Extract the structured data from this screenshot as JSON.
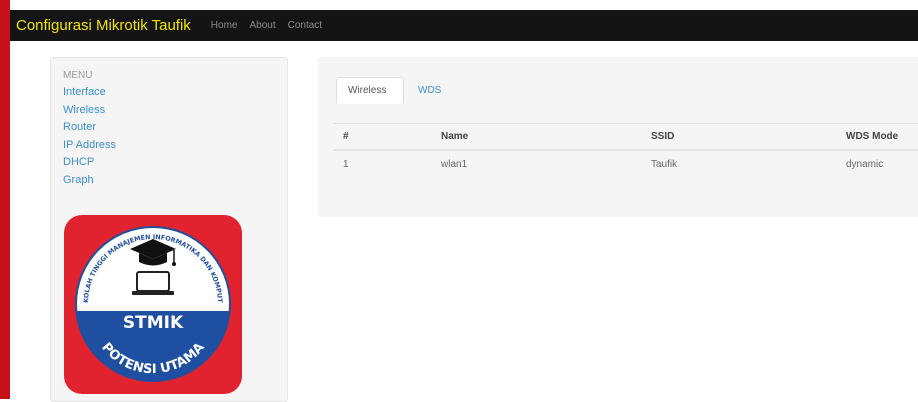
{
  "navbar": {
    "brand": "Configurasi Mikrotik Taufik",
    "links": [
      "Home",
      "About",
      "Contact"
    ]
  },
  "sidebar": {
    "header": "Menu",
    "items": [
      "Interface",
      "Wireless",
      "Router",
      "IP Address",
      "DHCP",
      "Graph"
    ]
  },
  "logo": {
    "ring_text": "SEKOLAH TINGGI MANAJEMEN INFORMATIKA DAN KOMPUTER",
    "line1": "STMIK",
    "line2": "POTENSI UTAMA",
    "colors": {
      "background": "#e0232e",
      "upper": "#ffffff",
      "lower": "#1f4fa0",
      "ring": "#1f4fa0"
    }
  },
  "tabs": [
    {
      "label": "Wireless",
      "active": true
    },
    {
      "label": "WDS",
      "active": false
    }
  ],
  "table": {
    "headers": [
      "#",
      "Name",
      "SSID",
      "WDS Mode"
    ],
    "rows": [
      [
        "1",
        "wlan1",
        "Taufik",
        "dynamic"
      ]
    ]
  },
  "colors": {
    "brand_text": "#f2e600",
    "navbar_bg": "#141414",
    "link": "#3a8fd0",
    "left_edge": "#c8101a"
  }
}
